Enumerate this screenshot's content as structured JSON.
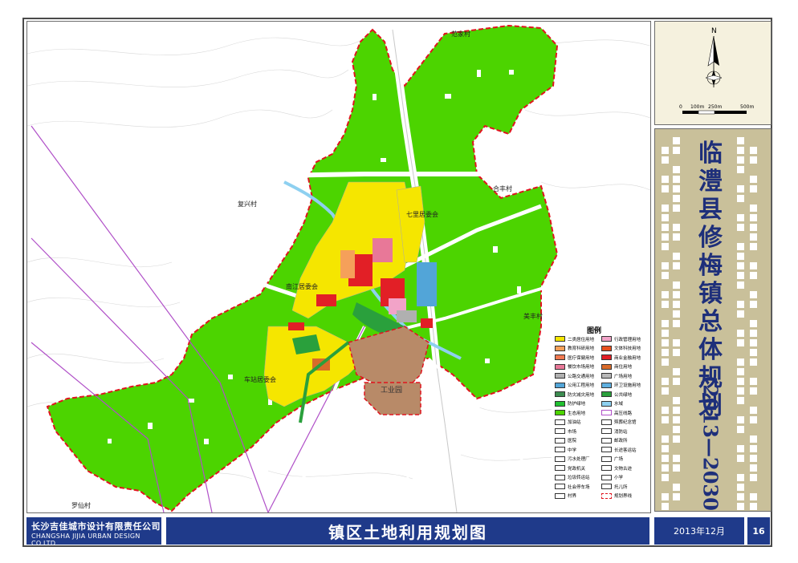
{
  "title": {
    "chars": [
      "临",
      "澧",
      "县",
      "修",
      "梅",
      "镇",
      "总",
      "体",
      "规",
      "划"
    ],
    "years": "(2013—2030)"
  },
  "plan_title": "镇区土地利用规划图",
  "company": {
    "cn": "长沙吉佳城市设计有限责任公司",
    "en": "CHANGSHA JIJIA URBAN DESIGN CO.LTD"
  },
  "date": "2013年12月",
  "page_number": "16",
  "north": {
    "label": "N",
    "scale_labels": [
      "0",
      "100m",
      "250m",
      "500m"
    ]
  },
  "map_labels": {
    "fanjiacun": "范家村",
    "fuxingcun": "复兴村",
    "hefengcun": "合丰村",
    "qilijuweihui": "七里居委会",
    "nanjiangjuweihui": "南江居委会",
    "meifengcun": "美丰村",
    "chezhanjuweihui": "车站居委会",
    "gongyeyuan": "工业园",
    "luoxiancun": "罗仙村"
  },
  "legend": {
    "title": "图例",
    "items": [
      {
        "label": "二类居住用地",
        "color": "#f5e600"
      },
      {
        "label": "行政管理用地",
        "color": "#f2a3c8"
      },
      {
        "label": "教育科研用地",
        "color": "#f5a05a"
      },
      {
        "label": "文体科技用地",
        "color": "#e8501e"
      },
      {
        "label": "医疗保健用地",
        "color": "#f07850"
      },
      {
        "label": "商业金融用地",
        "color": "#e21f26"
      },
      {
        "label": "餐饮市场用地",
        "color": "#e87898"
      },
      {
        "label": "商住用地",
        "color": "#d96b2a"
      },
      {
        "label": "公路交通用地",
        "color": "#b0b0b0"
      },
      {
        "label": "广场用地",
        "color": "#b9b9b9"
      },
      {
        "label": "公用工程用地",
        "color": "#52a5d8"
      },
      {
        "label": "环卫设施用地",
        "color": "#60b0e0"
      },
      {
        "label": "防灾减灾用地",
        "color": "#3c8c50"
      },
      {
        "label": "公共绿地",
        "color": "#2aa03c"
      },
      {
        "label": "防护绿地",
        "color": "#20c030"
      },
      {
        "label": "水域",
        "color": "#8ed0f0"
      },
      {
        "label": "生态用地",
        "color": "#4cd400"
      },
      {
        "label": "高压线路",
        "color": "#ffffff"
      },
      {
        "label": "加油站",
        "color": "#ffffff"
      },
      {
        "label": "殡葬纪念馆",
        "color": "#ffffff"
      },
      {
        "label": "市场",
        "color": "#ffffff"
      },
      {
        "label": "消防站",
        "color": "#ffffff"
      },
      {
        "label": "医院",
        "color": "#ffffff"
      },
      {
        "label": "邮政所",
        "color": "#ffffff"
      },
      {
        "label": "中学",
        "color": "#ffffff"
      },
      {
        "label": "长途客运站",
        "color": "#ffffff"
      },
      {
        "label": "污水处理厂",
        "color": "#ffffff"
      },
      {
        "label": "广场",
        "color": "#ffffff"
      },
      {
        "label": "党政机关",
        "color": "#ffffff"
      },
      {
        "label": "文物古迹",
        "color": "#ffffff"
      },
      {
        "label": "垃圾转运站",
        "color": "#ffffff"
      },
      {
        "label": "小学",
        "color": "#ffffff"
      },
      {
        "label": "社会停车场",
        "color": "#ffffff"
      },
      {
        "label": "托儿所",
        "color": "#ffffff"
      },
      {
        "label": "村界",
        "color": "#ffffff"
      },
      {
        "label": "规划界线",
        "color": "#ffffff"
      }
    ]
  },
  "colors": {
    "eco_green": "#4cd400",
    "residential": "#f5e600",
    "commercial": "#e21f26",
    "industrial": "#b88a68",
    "boundary": "#e0141e",
    "power_line": "#b050c8",
    "frame_blue": "#1f3a8a",
    "title_panel": "#c9c09a",
    "title_text": "#1e2f7a"
  },
  "icons": [
    "north-arrow-icon",
    "scale-bar-icon"
  ]
}
